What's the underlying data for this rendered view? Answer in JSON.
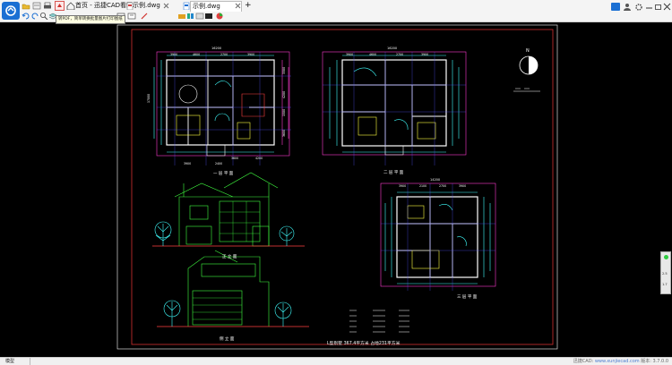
{
  "tabs": [
    {
      "label": "首页 - 迅捷CAD看图"
    },
    {
      "label": "示例.dwg"
    },
    {
      "label": "示例.dwg"
    }
  ],
  "tooltip": "转PDF，简单转换批量图片打印图纸",
  "tab_add": "+",
  "window_controls": [
    "min",
    "restore",
    "close"
  ],
  "drawing": {
    "plan1_title": "一 层 平 面",
    "plan2_title": "二 层 平 面",
    "plan3_title": "三 层 平 面",
    "elev1_title": "正 立 面",
    "elev2_title": "侧 立 面",
    "north": "N",
    "area_info": "L型别墅    367.4平方米    占地231平方米",
    "dims_top": [
      "3900",
      "4600",
      "2700",
      "3900"
    ],
    "dims_top_total": "16200",
    "dims_bottom": [
      "3900",
      "2400",
      "3600",
      "4200"
    ],
    "dims_right": [
      "3300",
      "4200",
      "1500",
      "3600"
    ],
    "dims_total_left": "17000",
    "plan2_dims_top": [
      "3900",
      "4600",
      "2700",
      "3900"
    ],
    "plan2_dims_total": "16200",
    "plan3_dims_top": [
      "3900",
      "2100",
      "2700",
      "3900"
    ],
    "plan3_dims_total": "14200"
  },
  "status": {
    "model_tab": "模型",
    "version_prefix": "迅捷CAD: ",
    "url": "www.xunjiecad.com",
    "version": " 版本: 3.7.0.0"
  },
  "right_panel": {
    "v1": "2.5",
    "v2": "1.7"
  }
}
